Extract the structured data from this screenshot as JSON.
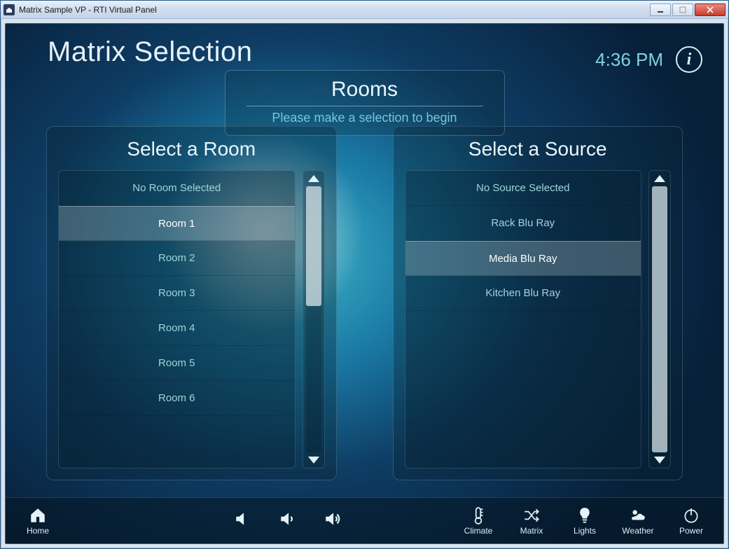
{
  "window_title": "Matrix Sample VP - RTI Virtual Panel",
  "page_title": "Matrix Selection",
  "clock": "4:36 PM",
  "rooms_header": {
    "title": "Rooms",
    "subtitle": "Please make a selection to begin"
  },
  "room_panel": {
    "title": "Select a Room",
    "items": [
      "No Room Selected",
      "Room 1",
      "Room 2",
      "Room 3",
      "Room 4",
      "Room 5",
      "Room 6"
    ],
    "selected_index": 1,
    "thumb": {
      "top_pct": 0,
      "height_pct": 45
    }
  },
  "source_panel": {
    "title": "Select a Source",
    "items": [
      "No Source Selected",
      "Rack Blu Ray",
      "Media Blu Ray",
      "Kitchen Blu Ray"
    ],
    "selected_index": 2,
    "thumb": {
      "top_pct": 0,
      "height_pct": 100
    }
  },
  "bottombar": {
    "home": "Home",
    "climate": "Climate",
    "matrix": "Matrix",
    "lights": "Lights",
    "weather": "Weather",
    "power": "Power"
  }
}
